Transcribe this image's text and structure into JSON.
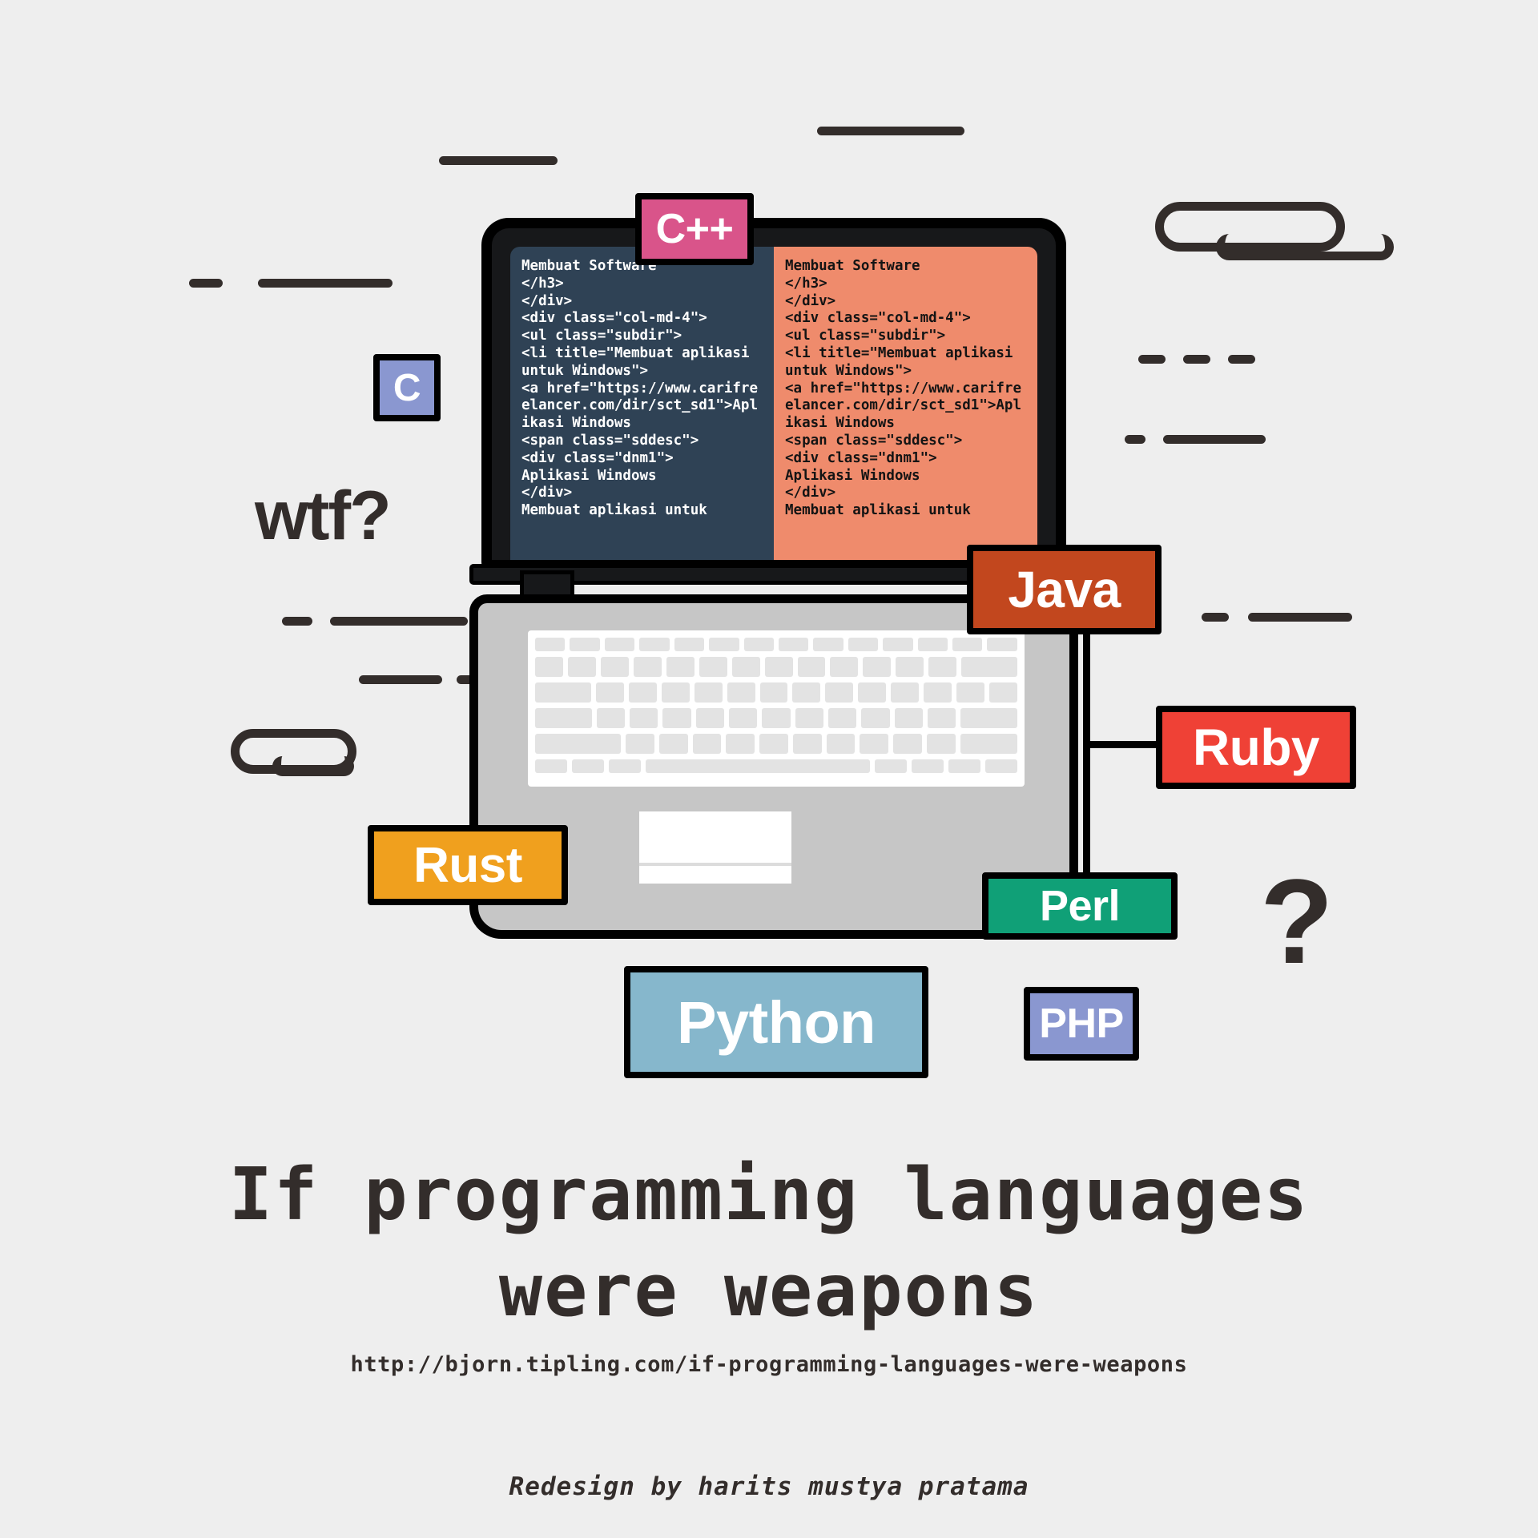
{
  "background_color": "#eeeeee",
  "ink_color": "#332d2b",
  "headline": {
    "line1": "If programming languages",
    "line2": "were weapons"
  },
  "url": "http://bjorn.tipling.com/if-programming-languages-were-weapons",
  "credit": "Redesign by harits mustya pratama",
  "annotations": {
    "wtf": "wtf?",
    "question_mark": "?"
  },
  "laptop": {
    "screen": {
      "left_pane": {
        "background_color": "#2f4255",
        "text_color": "#ffffff",
        "code": "Membuat Software\n</h3>\n</div>\n<div class=\"col-md-4\">\n<ul class=\"subdir\">\n<li title=\"Membuat aplikasi untuk Windows\">\n<a href=\"https://www.carifreelancer.com/dir/sct_sd1\">Aplikasi Windows\n<span class=\"sddesc\">\n<div class=\"dnm1\">\nAplikasi Windows\n</div>\nMembuat aplikasi untuk"
      },
      "right_pane": {
        "background_color": "#ef8b6c",
        "text_color": "#141414",
        "code": "Membuat Software\n</h3>\n</div>\n<div class=\"col-md-4\">\n<ul class=\"subdir\">\n<li title=\"Membuat aplikasi untuk Windows\">\n<a href=\"https://www.carifreelancer.com/dir/sct_sd1\">Aplikasi Windows\n<span class=\"sddesc\">\n<div class=\"dnm1\">\nAplikasi Windows\n</div>\nMembuat aplikasi untuk"
      }
    }
  },
  "badges": [
    {
      "id": "cpp",
      "label": "C++",
      "color": "#d9548a",
      "text_color": "#ffffff"
    },
    {
      "id": "c",
      "label": "C",
      "color": "#8a97d0",
      "text_color": "#ffffff"
    },
    {
      "id": "java",
      "label": "Java",
      "color": "#c2471e",
      "text_color": "#ffffff"
    },
    {
      "id": "ruby",
      "label": "Ruby",
      "color": "#ef4136",
      "text_color": "#ffffff"
    },
    {
      "id": "rust",
      "label": "Rust",
      "color": "#f0a01e",
      "text_color": "#ffffff"
    },
    {
      "id": "perl",
      "label": "Perl",
      "color": "#10a077",
      "text_color": "#ffffff"
    },
    {
      "id": "python",
      "label": "Python",
      "color": "#86b7cc",
      "text_color": "#ffffff"
    },
    {
      "id": "php",
      "label": "PHP",
      "color": "#8a97d0",
      "text_color": "#ffffff"
    }
  ]
}
